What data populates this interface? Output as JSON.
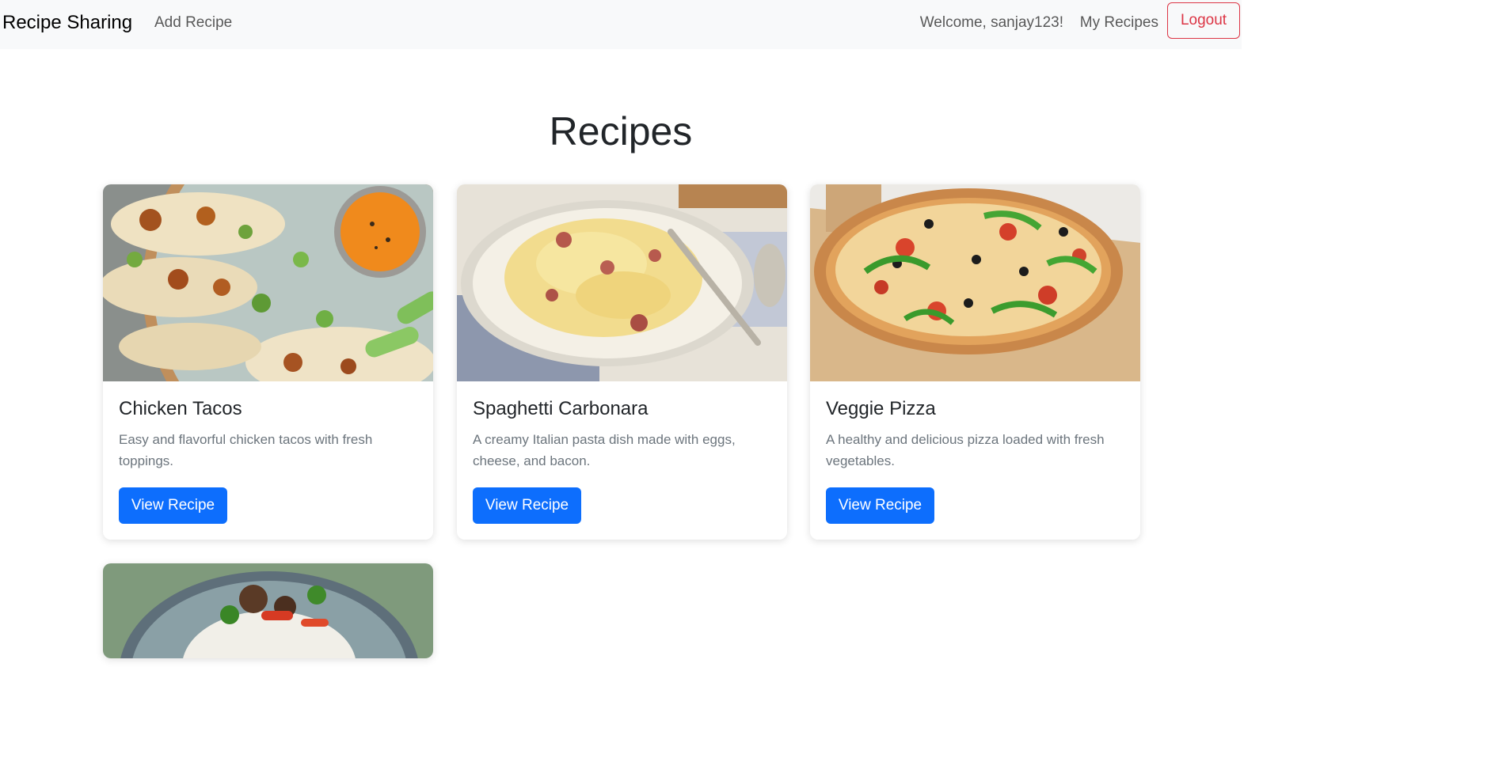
{
  "navbar": {
    "brand": "Recipe Sharing",
    "add_recipe": "Add Recipe",
    "welcome": "Welcome, sanjay123!",
    "my_recipes": "My Recipes",
    "logout": "Logout"
  },
  "main": {
    "title": "Recipes",
    "cards": [
      {
        "title": "Chicken Tacos",
        "description": "Easy and flavorful chicken tacos with fresh toppings.",
        "button": "View Recipe"
      },
      {
        "title": "Spaghetti Carbonara",
        "description": "A creamy Italian pasta dish made with eggs, cheese, and bacon.",
        "button": "View Recipe"
      },
      {
        "title": "Veggie Pizza",
        "description": "A healthy and delicious pizza loaded with fresh vegetables.",
        "button": "View Recipe"
      }
    ]
  },
  "colors": {
    "primary": "#0d6efd",
    "danger": "#dc3545",
    "navbar_bg": "#f8f9fa",
    "muted_text": "#6c757d"
  }
}
